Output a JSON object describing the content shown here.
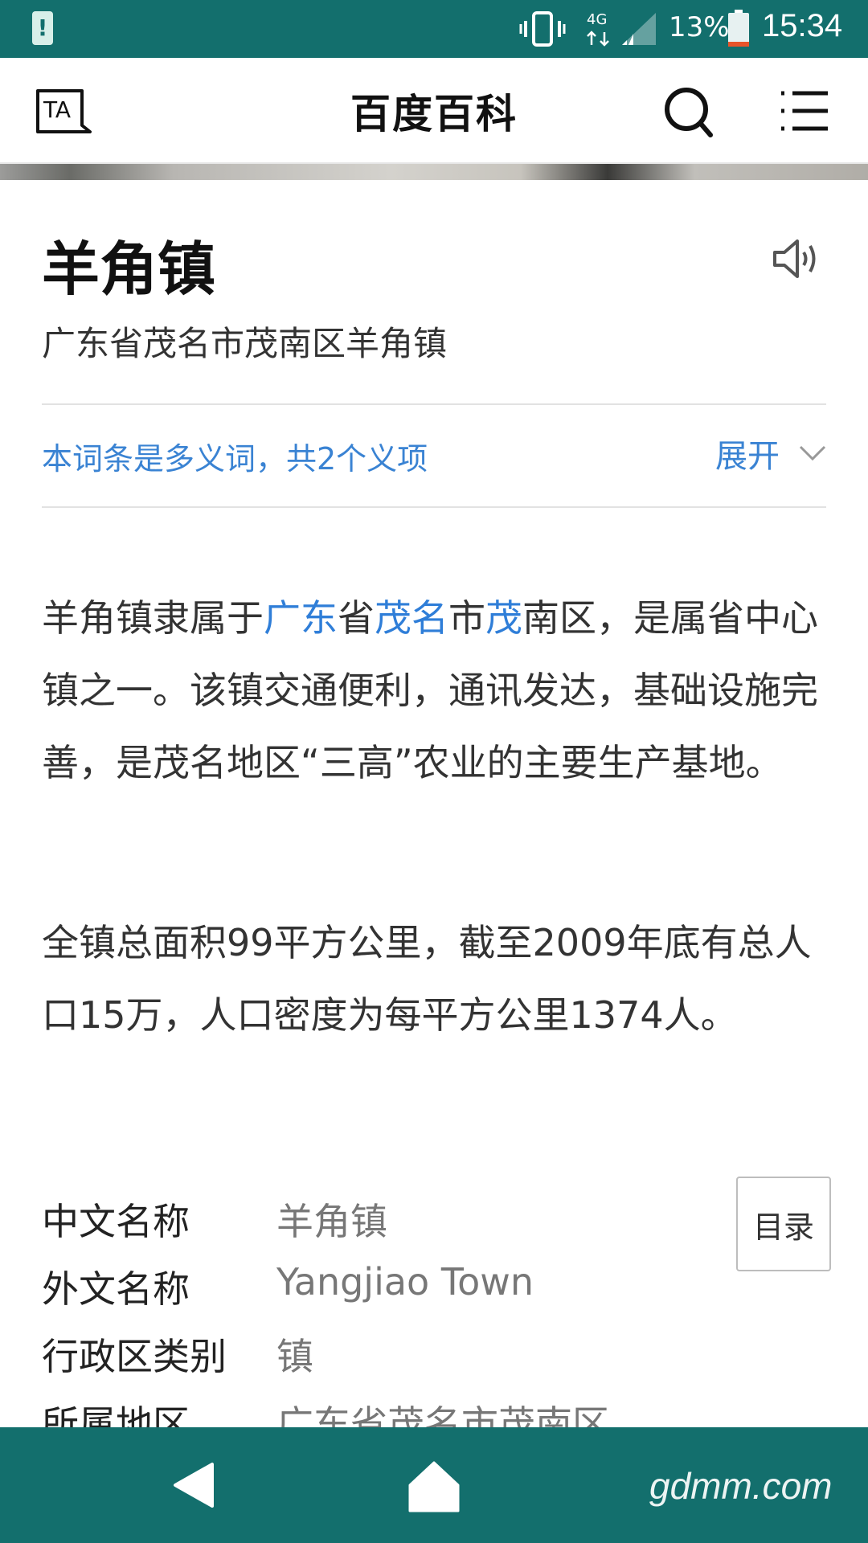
{
  "status_bar": {
    "network": "4G",
    "battery_percent": "13%",
    "time": "15:34"
  },
  "header": {
    "title": "百度百科",
    "ta_label": "TA"
  },
  "entry": {
    "title": "羊角镇",
    "subtitle": "广东省茂名市茂南区羊角镇",
    "polysemy_note": "本词条是多义词，共2个义项",
    "expand_label": "展开"
  },
  "summary": {
    "p1_prefix": "羊角镇隶属于",
    "p1_link1": "广东",
    "p1_mid1": "省",
    "p1_link2": "茂名",
    "p1_mid2": "市",
    "p1_link3": "茂",
    "p1_suffix": "南区，是属省中心镇之一。该镇交通便利，通讯发达，基础设施完善，是茂名地区“三高”农业的主要生产基地。",
    "p2": "全镇总面积99平方公里，截至2009年底有总人口15万，人口密度为每平方公里1374人。"
  },
  "info_table": [
    {
      "label": "中文名称",
      "value": "羊角镇"
    },
    {
      "label": "外文名称",
      "value": "Yangjiao Town"
    },
    {
      "label": "行政区类别",
      "value": "镇"
    },
    {
      "label": "所属地区",
      "value": "广东省茂名市茂南区"
    }
  ],
  "toc_label": "目录",
  "watermark": "gdmm.com",
  "colors": {
    "system_bar": "#136f6d",
    "link": "#2f7ed8",
    "note": "#3a83d3"
  }
}
